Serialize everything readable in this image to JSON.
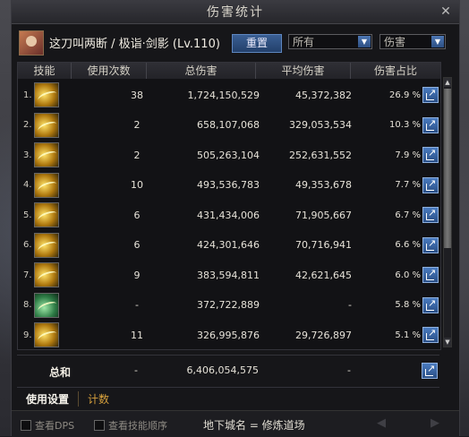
{
  "window": {
    "title": "伤害统计",
    "close": "✕"
  },
  "player": {
    "name": "这刀叫两断 / 极诣·剑影 (Lv.110)"
  },
  "controls": {
    "reset_label": "重置",
    "filter_value": "所有",
    "type_value": "伤害",
    "dropdown_arrow": "▼"
  },
  "table": {
    "headers": [
      "技能",
      "使用次数",
      "总伤害",
      "平均伤害",
      "伤害占比"
    ],
    "rows": [
      {
        "rank": "1.",
        "icon": "gold-slash-icon",
        "count": "38",
        "total": "1,724,150,529",
        "avg": "45,372,382",
        "pct": "26.9 %"
      },
      {
        "rank": "2.",
        "icon": "gold-slash-icon",
        "count": "2",
        "total": "658,107,068",
        "avg": "329,053,534",
        "pct": "10.3 %"
      },
      {
        "rank": "3.",
        "icon": "gold-slash-icon",
        "count": "2",
        "total": "505,263,104",
        "avg": "252,631,552",
        "pct": "7.9 %"
      },
      {
        "rank": "4.",
        "icon": "gold-slash-icon",
        "count": "10",
        "total": "493,536,783",
        "avg": "49,353,678",
        "pct": "7.7 %"
      },
      {
        "rank": "5.",
        "icon": "gold-slash-icon",
        "count": "6",
        "total": "431,434,006",
        "avg": "71,905,667",
        "pct": "6.7 %"
      },
      {
        "rank": "6.",
        "icon": "gold-slash-icon",
        "count": "6",
        "total": "424,301,646",
        "avg": "70,716,941",
        "pct": "6.6 %"
      },
      {
        "rank": "7.",
        "icon": "gold-slash-icon",
        "count": "9",
        "total": "383,594,811",
        "avg": "42,621,645",
        "pct": "6.0 %"
      },
      {
        "rank": "8.",
        "icon": "green-slash-icon",
        "count": "-",
        "total": "372,722,889",
        "avg": "-",
        "pct": "5.8 %"
      },
      {
        "rank": "9.",
        "icon": "gold-slash-icon",
        "count": "11",
        "total": "326,995,876",
        "avg": "29,726,897",
        "pct": "5.1 %"
      }
    ]
  },
  "totals": {
    "label": "总和",
    "count": "-",
    "total": "6,406,054,575",
    "avg": "-"
  },
  "tabs": {
    "settings": "使用设置",
    "count": "计数"
  },
  "footer": {
    "show_dps": "查看DPS",
    "show_skill_order": "查看技能顺序",
    "dungeon": "地下城名 = 修炼道场",
    "prev": "◀",
    "next": "▶"
  },
  "colors": {
    "accent_blue": "#3a5f93",
    "tab_gold": "#d6a03c"
  }
}
